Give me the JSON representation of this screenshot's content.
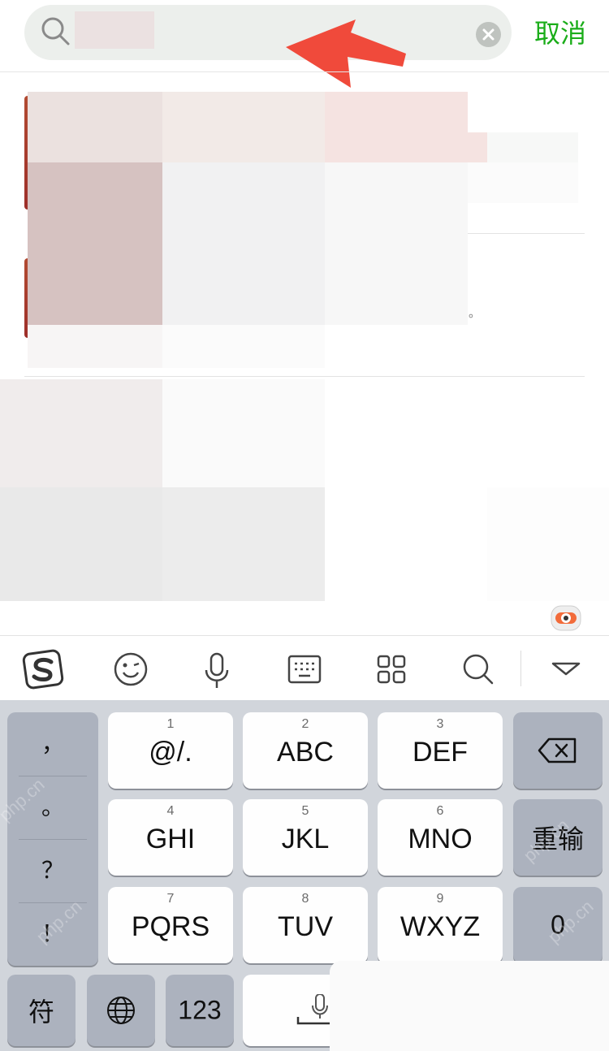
{
  "search": {
    "placeholder": "",
    "cancel_label": "取消"
  },
  "results": {
    "trailing_punct": "。"
  },
  "toolbar": {
    "items": [
      "sogou-logo",
      "emoji",
      "voice",
      "keyboard",
      "apps",
      "search",
      "collapse"
    ]
  },
  "keyboard": {
    "punctuation": [
      "，",
      "。",
      "？",
      "！"
    ],
    "keys": [
      {
        "num": "1",
        "label": "@/."
      },
      {
        "num": "2",
        "label": "ABC"
      },
      {
        "num": "3",
        "label": "DEF"
      },
      {
        "num": "4",
        "label": "GHI"
      },
      {
        "num": "5",
        "label": "JKL"
      },
      {
        "num": "6",
        "label": "MNO"
      },
      {
        "num": "7",
        "label": "PQRS"
      },
      {
        "num": "8",
        "label": "TUV"
      },
      {
        "num": "9",
        "label": "WXYZ"
      }
    ],
    "reinput_label": "重输",
    "zero_label": "0",
    "symbol_label": "符",
    "numeric_label": "123"
  },
  "watermark": "php.cn",
  "colors": {
    "accent": "#1aad19",
    "arrow": "#f04a3b",
    "keyboard_bg": "#d1d5db"
  }
}
